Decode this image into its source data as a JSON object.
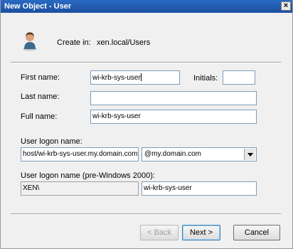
{
  "window": {
    "title": "New Object - User",
    "close_glyph": "×"
  },
  "header": {
    "create_in_label": "Create in:",
    "create_in_path": "xen.local/Users",
    "icon": "user-icon"
  },
  "form": {
    "first_name_label": "First name:",
    "first_name_value": "wi-krb-sys-user",
    "initials_label": "Initials:",
    "initials_value": "",
    "last_name_label": "Last name:",
    "last_name_value": "",
    "full_name_label": "Full name:",
    "full_name_value": "wi-krb-sys-user",
    "logon_name_label": "User logon name:",
    "logon_name_value": "host/wi-krb-sys-user.my.domain.com",
    "domain_suffix_selected": "@my.domain.com",
    "pre2000_label": "User logon name (pre-Windows 2000):",
    "pre2000_domain_value": "XEN\\",
    "pre2000_user_value": "wi-krb-sys-user"
  },
  "buttons": {
    "back": "< Back",
    "next": "Next >",
    "cancel": "Cancel"
  }
}
